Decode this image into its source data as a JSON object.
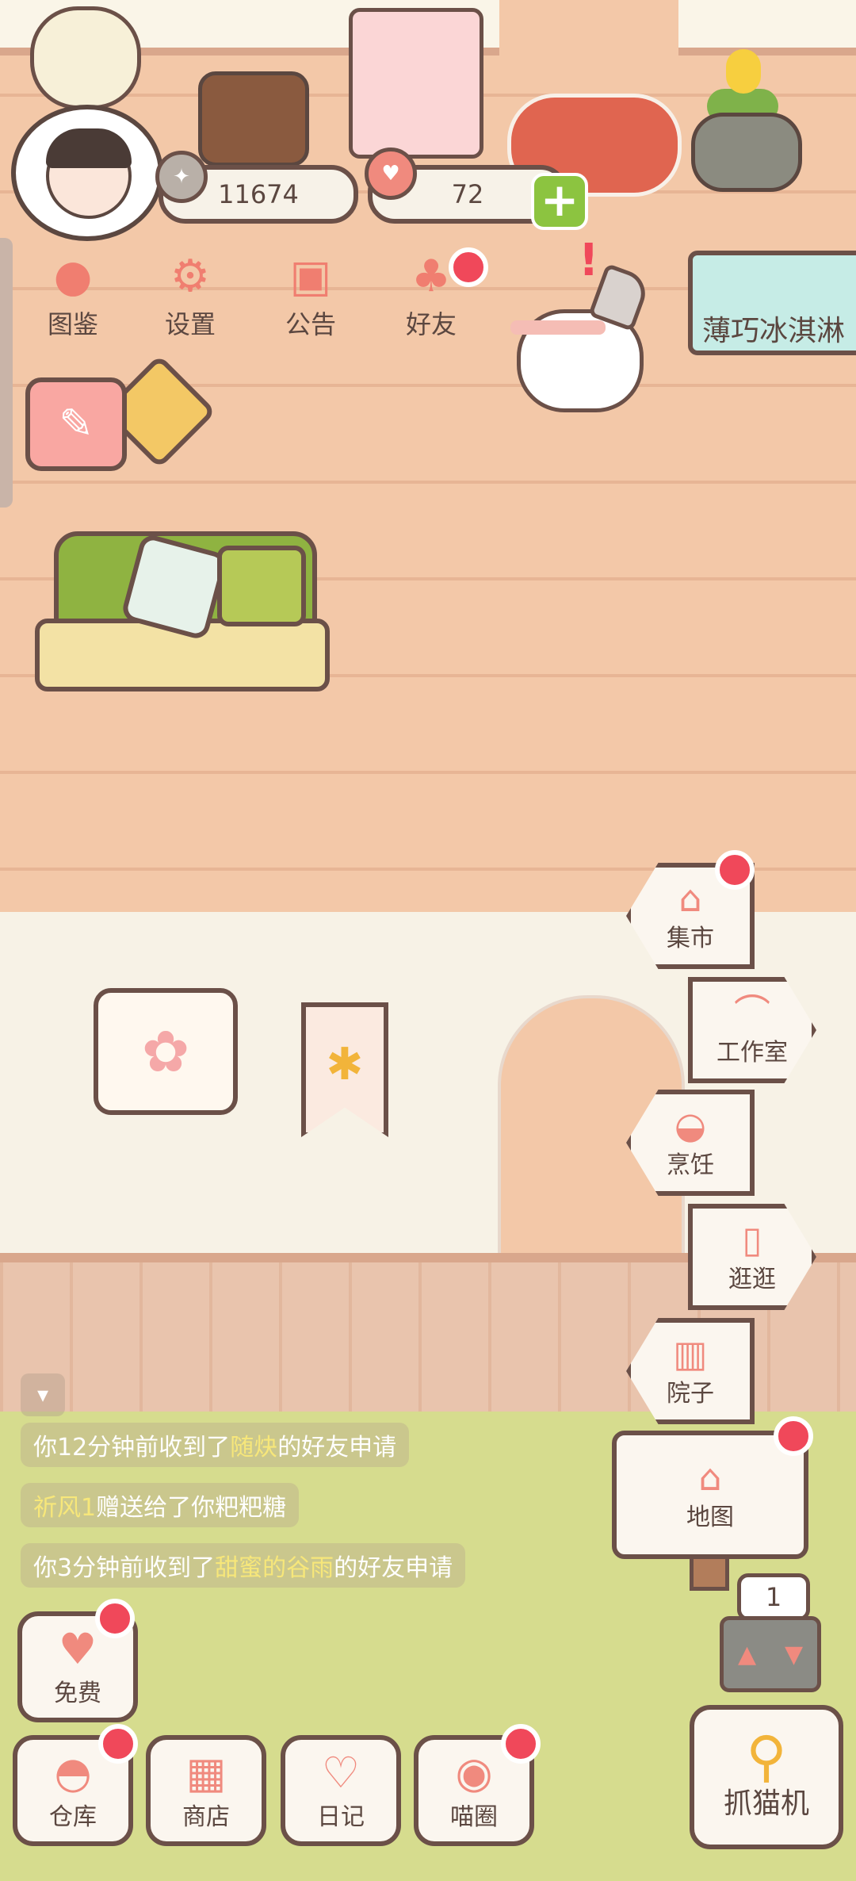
{
  "currency": {
    "coins": "11674",
    "hearts": "72"
  },
  "menu": {
    "guide": "图鉴",
    "settings": "设置",
    "notice": "公告",
    "friends": "好友"
  },
  "sign_text": "薄巧冰淇淋",
  "nav": {
    "market": "集市",
    "workshop": "工作室",
    "cooking": "烹饪",
    "stroll": "逛逛",
    "yard": "院子",
    "map": "地图"
  },
  "chat": {
    "msg1": {
      "pre": "你12分钟前收到了",
      "name": "随炔",
      "post": "的好友申请"
    },
    "msg2": {
      "name": "祈风1",
      "post": "赠送给了你粑粑糖"
    },
    "msg3": {
      "pre": "你3分钟前收到了",
      "name": "甜蜜的谷雨",
      "post": "的好友申请"
    }
  },
  "bottom": {
    "free": "免费",
    "storage": "仓库",
    "shop": "商店",
    "diary": "日记",
    "meow": "喵圈",
    "claw": "抓猫机"
  },
  "slot_count": "1",
  "icons": {
    "guide": "cat-face-icon",
    "settings": "gear-icon",
    "notice": "gift-icon",
    "friends": "friends-icon",
    "market": "market-stall-icon",
    "workshop": "hanger-icon",
    "cooking": "pot-icon",
    "stroll": "door-icon",
    "yard": "fence-icon",
    "map": "house-icon",
    "free": "heart-icon",
    "storage": "storage-icon",
    "shop": "shop-icon",
    "diary": "notebook-icon",
    "meow": "planet-cat-icon",
    "claw": "claw-icon"
  },
  "colors": {
    "accent": "#f08a7e",
    "badge": "#f0485a",
    "outline": "#6b5048",
    "plus": "#8cc440"
  }
}
